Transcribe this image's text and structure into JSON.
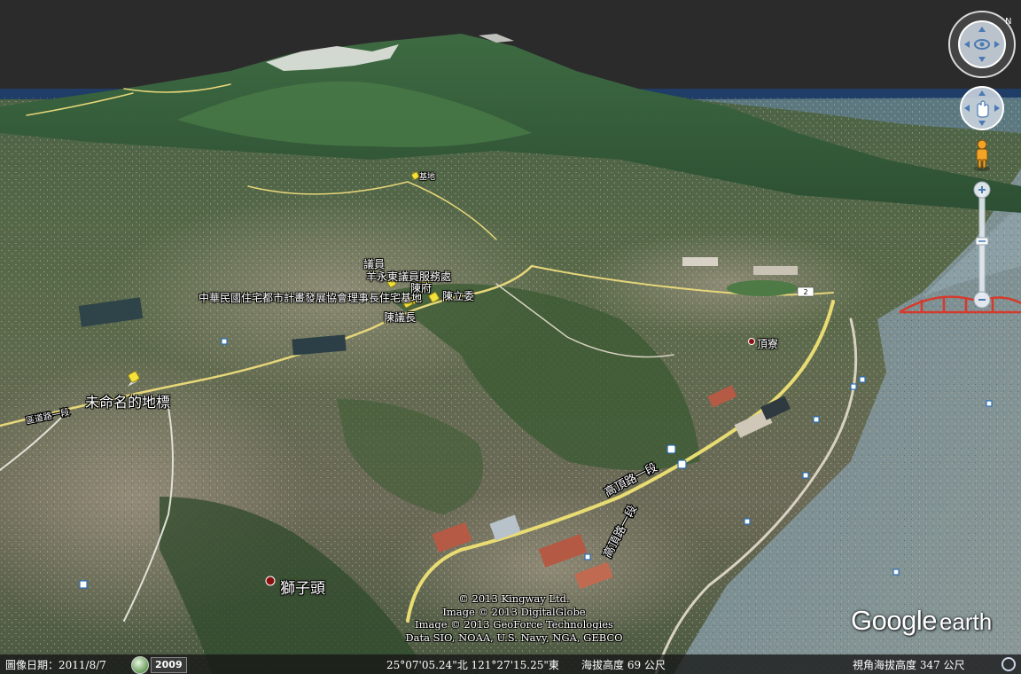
{
  "map": {
    "placemarks": [
      {
        "name": "unnamed-landmark",
        "label": "未命名的地標"
      },
      {
        "name": "shizitou",
        "label": "獅子頭"
      },
      {
        "name": "dingliao",
        "label": "頂寮"
      },
      {
        "name": "chen-councilor",
        "label": "陳議長"
      },
      {
        "name": "chen-lizeng",
        "label": "陳立委"
      },
      {
        "name": "association",
        "label": "中華民國住宅都市計畫發展協會理事長住宅基地"
      },
      {
        "name": "councilor-office",
        "label": "議員"
      },
      {
        "name": "councilor-office-2",
        "label": "羊永東議員服務處"
      },
      {
        "name": "chen-residence",
        "label": "陳府"
      },
      {
        "name": "peak-marker",
        "label": "基地"
      }
    ],
    "road_labels": [
      "高頂路一段",
      "高頂路一段",
      "區道路一段"
    ],
    "highway_badge": "2"
  },
  "credits": [
    "© 2013 Kingway Ltd.",
    "Image © 2013 DigitalGlobe",
    "Image © 2013 GeoForce Technologies",
    "Data SIO, NOAA, U.S. Navy, NGA, GEBCO"
  ],
  "logo": {
    "google": "Google",
    "earth": "earth"
  },
  "status": {
    "imagery_date": "圖像日期：2011/8/7",
    "year": "2009",
    "coordinates": "25°07'05.24\"北 121°27'15.25\"東",
    "elevation": "海拔高度   69 公尺",
    "eye_altitude": "視角海拔高度    347 公尺"
  },
  "controls": {
    "north_label": "N"
  },
  "colors": {
    "sky": "#2b2b2b",
    "statusbar": "#161616",
    "pushpin": "#f4e13a",
    "water": "#3f5b6a"
  }
}
